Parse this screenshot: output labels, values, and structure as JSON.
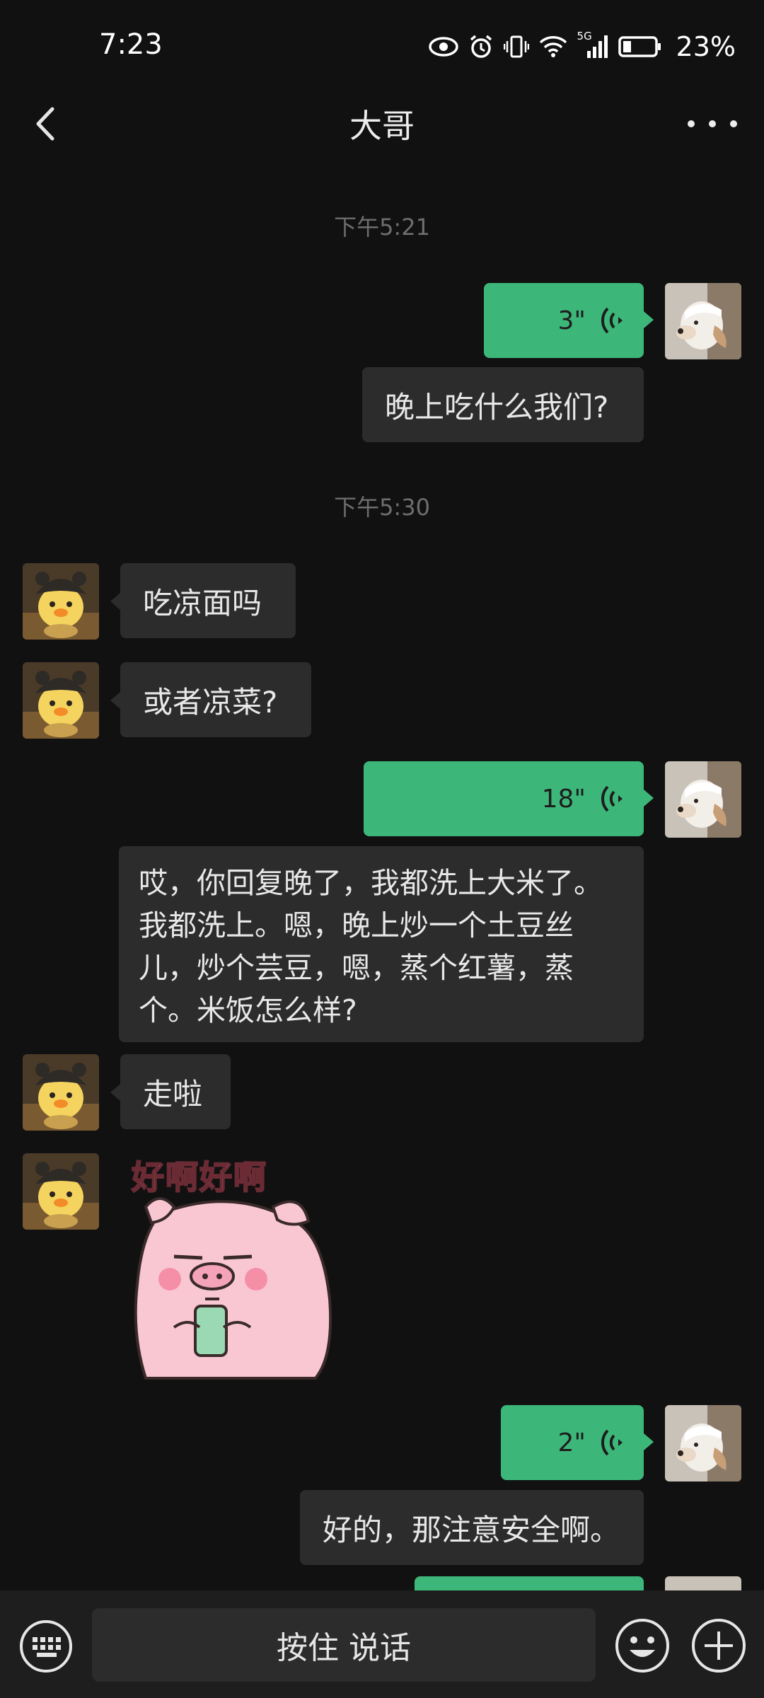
{
  "status_bar": {
    "time": "7:23",
    "network": "5G",
    "battery": "23%"
  },
  "header": {
    "title": "大哥"
  },
  "timestamps": [
    "下午5:21",
    "下午5:30"
  ],
  "messages": [
    {
      "side": "right",
      "type": "voice",
      "duration": "3\""
    },
    {
      "side": "right",
      "type": "transcript",
      "text": "晚上吃什么我们?"
    },
    {
      "side": "left",
      "type": "text",
      "text": "吃凉面吗"
    },
    {
      "side": "left",
      "type": "text",
      "text": "或者凉菜?"
    },
    {
      "side": "right",
      "type": "voice",
      "duration": "18\""
    },
    {
      "side": "right",
      "type": "transcript",
      "lines": [
        "哎，你回复晚了，我都洗上大米了。",
        "我都洗上。嗯，晚上炒一个土豆丝",
        "儿，炒个芸豆，嗯，蒸个红薯，蒸",
        "个。米饭怎么样?"
      ]
    },
    {
      "side": "left",
      "type": "text",
      "text": "走啦"
    },
    {
      "side": "left",
      "type": "sticker",
      "caption": "好啊好啊"
    },
    {
      "side": "right",
      "type": "voice",
      "duration": "2\""
    },
    {
      "side": "right",
      "type": "transcript",
      "text": "好的，那注意安全啊。"
    }
  ],
  "input_bar": {
    "hold_to_talk": "按住 说话"
  },
  "colors": {
    "background": "#111111",
    "bubble_dark": "#2C2C2C",
    "voice_green": "#3DB779",
    "input_bar": "#1E1E1E"
  }
}
